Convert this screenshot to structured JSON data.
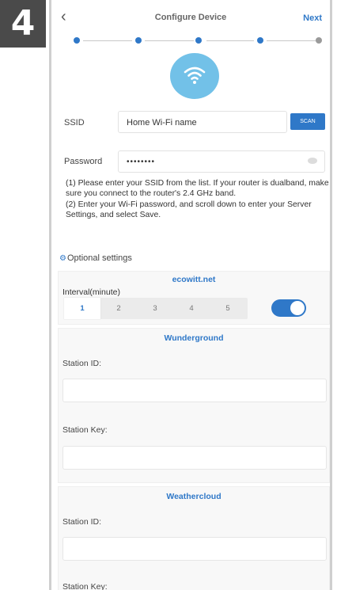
{
  "step_badge": "4",
  "header": {
    "title": "Configure Device",
    "next_label": "Next",
    "back_glyph": "‹"
  },
  "stepper": {
    "total": 5,
    "current": 4
  },
  "wifi_form": {
    "ssid_label": "SSID",
    "ssid_value": "Home Wi-Fi name",
    "scan_label": "SCAN",
    "password_label": "Password",
    "password_value": "••••••••"
  },
  "instructions": {
    "line1": "(1) Please enter your SSID from the list. If your router is dualband, make sure you connect to the router's 2.4 GHz band.",
    "line2": "(2) Enter your Wi-Fi password, and scroll down to enter your Server Settings, and select Save."
  },
  "optional": {
    "title": "Optional settings",
    "ecowitt": {
      "title": "ecowitt.net",
      "interval_label": "Interval(minute)",
      "interval_options": [
        "1",
        "2",
        "3",
        "4",
        "5"
      ],
      "selected_index": 0,
      "upload_enabled": true
    },
    "wunderground": {
      "title": "Wunderground",
      "station_id_label": "Station ID:",
      "station_key_label": "Station Key:"
    },
    "weathercloud": {
      "title": "Weathercloud",
      "station_id_label": "Station ID:",
      "station_key_label": "Station Key:"
    }
  },
  "colors": {
    "accent": "#2f78c8",
    "wifi_circle": "#72c1e8"
  }
}
